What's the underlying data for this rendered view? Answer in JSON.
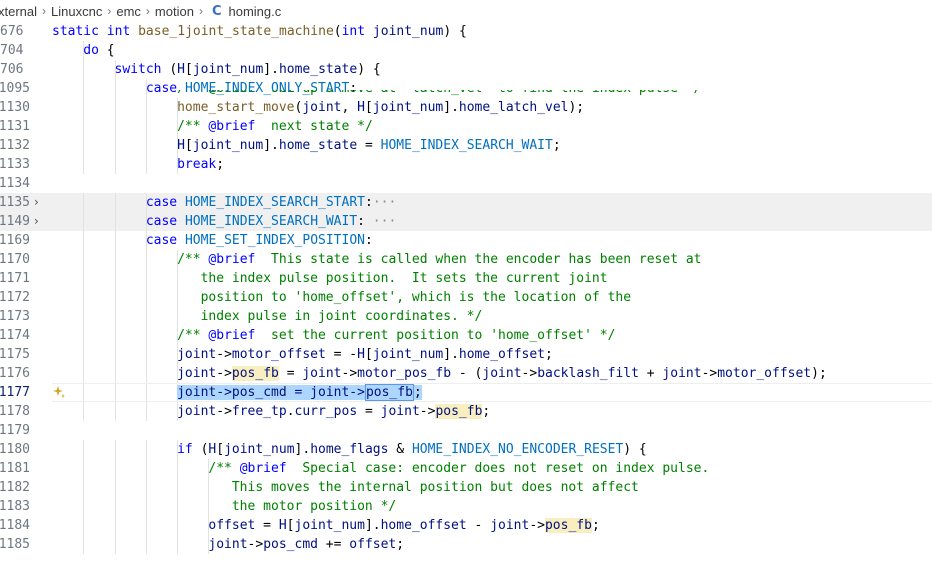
{
  "breadcrumb": {
    "items": [
      "xternal",
      "Linuxcnc",
      "emc",
      "motion"
    ],
    "file_icon": "C",
    "file_name": "homing.c"
  },
  "editor": {
    "lines": [
      {
        "num": "676",
        "tokens": [
          [
            "kw",
            "static "
          ],
          [
            "kw",
            "int "
          ],
          [
            "fn",
            "base_1joint_state_machine"
          ],
          [
            "op",
            "("
          ],
          [
            "kw",
            "int "
          ],
          [
            "var",
            "joint_num"
          ],
          [
            "op",
            ") {"
          ]
        ],
        "indent": 0
      },
      {
        "num": "704",
        "tokens": [
          [
            "kw",
            "do"
          ],
          [
            "op",
            " {"
          ]
        ],
        "indent": 4
      },
      {
        "num": "706",
        "tokens": [
          [
            "kw",
            "switch "
          ],
          [
            "op",
            "("
          ],
          [
            "var",
            "H"
          ],
          [
            "op",
            "["
          ],
          [
            "var",
            "joint_num"
          ],
          [
            "op",
            "]."
          ],
          [
            "var",
            "home_state"
          ],
          [
            "op",
            ") {"
          ]
        ],
        "indent": 8
      },
      {
        "num": "1095",
        "tokens": [
          [
            "kw",
            "case "
          ],
          [
            "enum",
            "HOME_INDEX_ONLY_START"
          ],
          [
            "op",
            ":"
          ]
        ],
        "indent": 12
      },
      {
        "num": "1130",
        "tokens": [
          [
            "fn",
            "home_start_move"
          ],
          [
            "op",
            "("
          ],
          [
            "var",
            "joint"
          ],
          [
            "op",
            ", "
          ],
          [
            "var",
            "H"
          ],
          [
            "op",
            "["
          ],
          [
            "var",
            "joint_num"
          ],
          [
            "op",
            "]."
          ],
          [
            "var",
            "home_latch_vel"
          ],
          [
            "op",
            ");"
          ]
        ],
        "indent": 16
      },
      {
        "num": "1131",
        "tokens": [
          [
            "cm",
            "/** "
          ],
          [
            "tag",
            "@brief"
          ],
          [
            "cm",
            "  next state */"
          ]
        ],
        "indent": 16
      },
      {
        "num": "1132",
        "tokens": [
          [
            "var",
            "H"
          ],
          [
            "op",
            "["
          ],
          [
            "var",
            "joint_num"
          ],
          [
            "op",
            "]."
          ],
          [
            "var",
            "home_state"
          ],
          [
            "op",
            " = "
          ],
          [
            "enum",
            "HOME_INDEX_SEARCH_WAIT"
          ],
          [
            "op",
            ";"
          ]
        ],
        "indent": 16
      },
      {
        "num": "1133",
        "tokens": [
          [
            "kw",
            "break"
          ],
          [
            "op",
            ";"
          ]
        ],
        "indent": 16
      },
      {
        "num": "1134",
        "tokens": [],
        "indent": 0
      },
      {
        "num": "1135",
        "fold": true,
        "tokens": [
          [
            "kw",
            "case "
          ],
          [
            "enum",
            "HOME_INDEX_SEARCH_START"
          ],
          [
            "op",
            ":"
          ],
          [
            "dots",
            "···"
          ]
        ],
        "indent": 12
      },
      {
        "num": "1149",
        "fold": true,
        "tokens": [
          [
            "kw",
            "case "
          ],
          [
            "enum",
            "HOME_INDEX_SEARCH_WAIT"
          ],
          [
            "op",
            ":"
          ],
          [
            "dots",
            " ···"
          ]
        ],
        "indent": 12
      },
      {
        "num": "1169",
        "tokens": [
          [
            "kw",
            "case "
          ],
          [
            "enum",
            "HOME_SET_INDEX_POSITION"
          ],
          [
            "op",
            ":"
          ]
        ],
        "indent": 12
      },
      {
        "num": "1170",
        "tokens": [
          [
            "cm",
            "/** "
          ],
          [
            "tag",
            "@brief"
          ],
          [
            "cm",
            "  This state is called when the encoder has been reset at"
          ]
        ],
        "indent": 16
      },
      {
        "num": "1171",
        "tokens": [
          [
            "cm",
            "the index pulse position.  It sets the current joint"
          ]
        ],
        "indent": 19
      },
      {
        "num": "1172",
        "tokens": [
          [
            "cm",
            "position to 'home_offset', which is the location of the"
          ]
        ],
        "indent": 19
      },
      {
        "num": "1173",
        "tokens": [
          [
            "cm",
            "index pulse in joint coordinates. */"
          ]
        ],
        "indent": 19
      },
      {
        "num": "1174",
        "tokens": [
          [
            "cm",
            "/** "
          ],
          [
            "tag",
            "@brief"
          ],
          [
            "cm",
            "  set the current position to 'home_offset' */"
          ]
        ],
        "indent": 16
      },
      {
        "num": "1175",
        "tokens": [
          [
            "var",
            "joint"
          ],
          [
            "op",
            "->"
          ],
          [
            "var",
            "motor_offset"
          ],
          [
            "op",
            " = -"
          ],
          [
            "var",
            "H"
          ],
          [
            "op",
            "["
          ],
          [
            "var",
            "joint_num"
          ],
          [
            "op",
            "]."
          ],
          [
            "var",
            "home_offset"
          ],
          [
            "op",
            ";"
          ]
        ],
        "indent": 16
      },
      {
        "num": "1176",
        "tokens": [
          [
            "var",
            "joint"
          ],
          [
            "op",
            "->"
          ],
          [
            "hlvar",
            "pos_fb"
          ],
          [
            "op",
            " = "
          ],
          [
            "var",
            "joint"
          ],
          [
            "op",
            "->"
          ],
          [
            "var",
            "motor_pos_fb"
          ],
          [
            "op",
            " - ("
          ],
          [
            "var",
            "joint"
          ],
          [
            "op",
            "->"
          ],
          [
            "var",
            "backlash_filt"
          ],
          [
            "op",
            " + "
          ],
          [
            "var",
            "joint"
          ],
          [
            "op",
            "->"
          ],
          [
            "var",
            "motor_offset"
          ],
          [
            "op",
            ");"
          ]
        ],
        "indent": 16
      },
      {
        "num": "1177",
        "current": true,
        "sparkle": true,
        "tokens": [
          [
            "selvar",
            "joint->pos_cmd = joint->"
          ],
          [
            "curvar",
            "pos_fb"
          ],
          [
            "selop",
            ";"
          ]
        ],
        "indent": 16
      },
      {
        "num": "1178",
        "tokens": [
          [
            "var",
            "joint"
          ],
          [
            "op",
            "->"
          ],
          [
            "var",
            "free_tp"
          ],
          [
            "op",
            "."
          ],
          [
            "var",
            "curr_pos"
          ],
          [
            "op",
            " = "
          ],
          [
            "var",
            "joint"
          ],
          [
            "op",
            "->"
          ],
          [
            "hlvar",
            "pos_fb"
          ],
          [
            "op",
            ";"
          ]
        ],
        "indent": 16
      },
      {
        "num": "1179",
        "tokens": [],
        "indent": 0
      },
      {
        "num": "1180",
        "tokens": [
          [
            "kw",
            "if "
          ],
          [
            "op",
            "("
          ],
          [
            "var",
            "H"
          ],
          [
            "op",
            "["
          ],
          [
            "var",
            "joint_num"
          ],
          [
            "op",
            "]."
          ],
          [
            "var",
            "home_flags"
          ],
          [
            "op",
            " & "
          ],
          [
            "enum",
            "HOME_INDEX_NO_ENCODER_RESET"
          ],
          [
            "op",
            ") {"
          ]
        ],
        "indent": 16
      },
      {
        "num": "1181",
        "tokens": [
          [
            "cm",
            "/** "
          ],
          [
            "tag",
            "@brief"
          ],
          [
            "cm",
            "  Special case: encoder does not reset on index pulse."
          ]
        ],
        "indent": 20
      },
      {
        "num": "1182",
        "tokens": [
          [
            "cm",
            "This moves the internal position but does not affect"
          ]
        ],
        "indent": 23
      },
      {
        "num": "1183",
        "tokens": [
          [
            "cm",
            "the motor position */"
          ]
        ],
        "indent": 23
      },
      {
        "num": "1184",
        "tokens": [
          [
            "var",
            "offset"
          ],
          [
            "op",
            " = "
          ],
          [
            "var",
            "H"
          ],
          [
            "op",
            "["
          ],
          [
            "var",
            "joint_num"
          ],
          [
            "op",
            "]."
          ],
          [
            "var",
            "home_offset"
          ],
          [
            "op",
            " - "
          ],
          [
            "var",
            "joint"
          ],
          [
            "op",
            "->"
          ],
          [
            "hlvar",
            "pos_fb"
          ],
          [
            "op",
            ";"
          ]
        ],
        "indent": 20
      },
      {
        "num": "1185",
        "tokens": [
          [
            "var",
            "joint"
          ],
          [
            "op",
            "->"
          ],
          [
            "var",
            "pos_cmd"
          ],
          [
            "op",
            " += "
          ],
          [
            "var",
            "offset"
          ],
          [
            "op",
            ";"
          ]
        ],
        "indent": 20
      }
    ],
    "sticky_comment": "/** @brief  set up a move at 'latch_vel' to find the index pulse */"
  },
  "colors": {
    "keyword": "#0000ff",
    "function": "#795e26",
    "variable": "#001080",
    "comment": "#008000",
    "enum": "#0070c1",
    "selection": "#add6ff",
    "word_highlight": "#f8eec0"
  }
}
